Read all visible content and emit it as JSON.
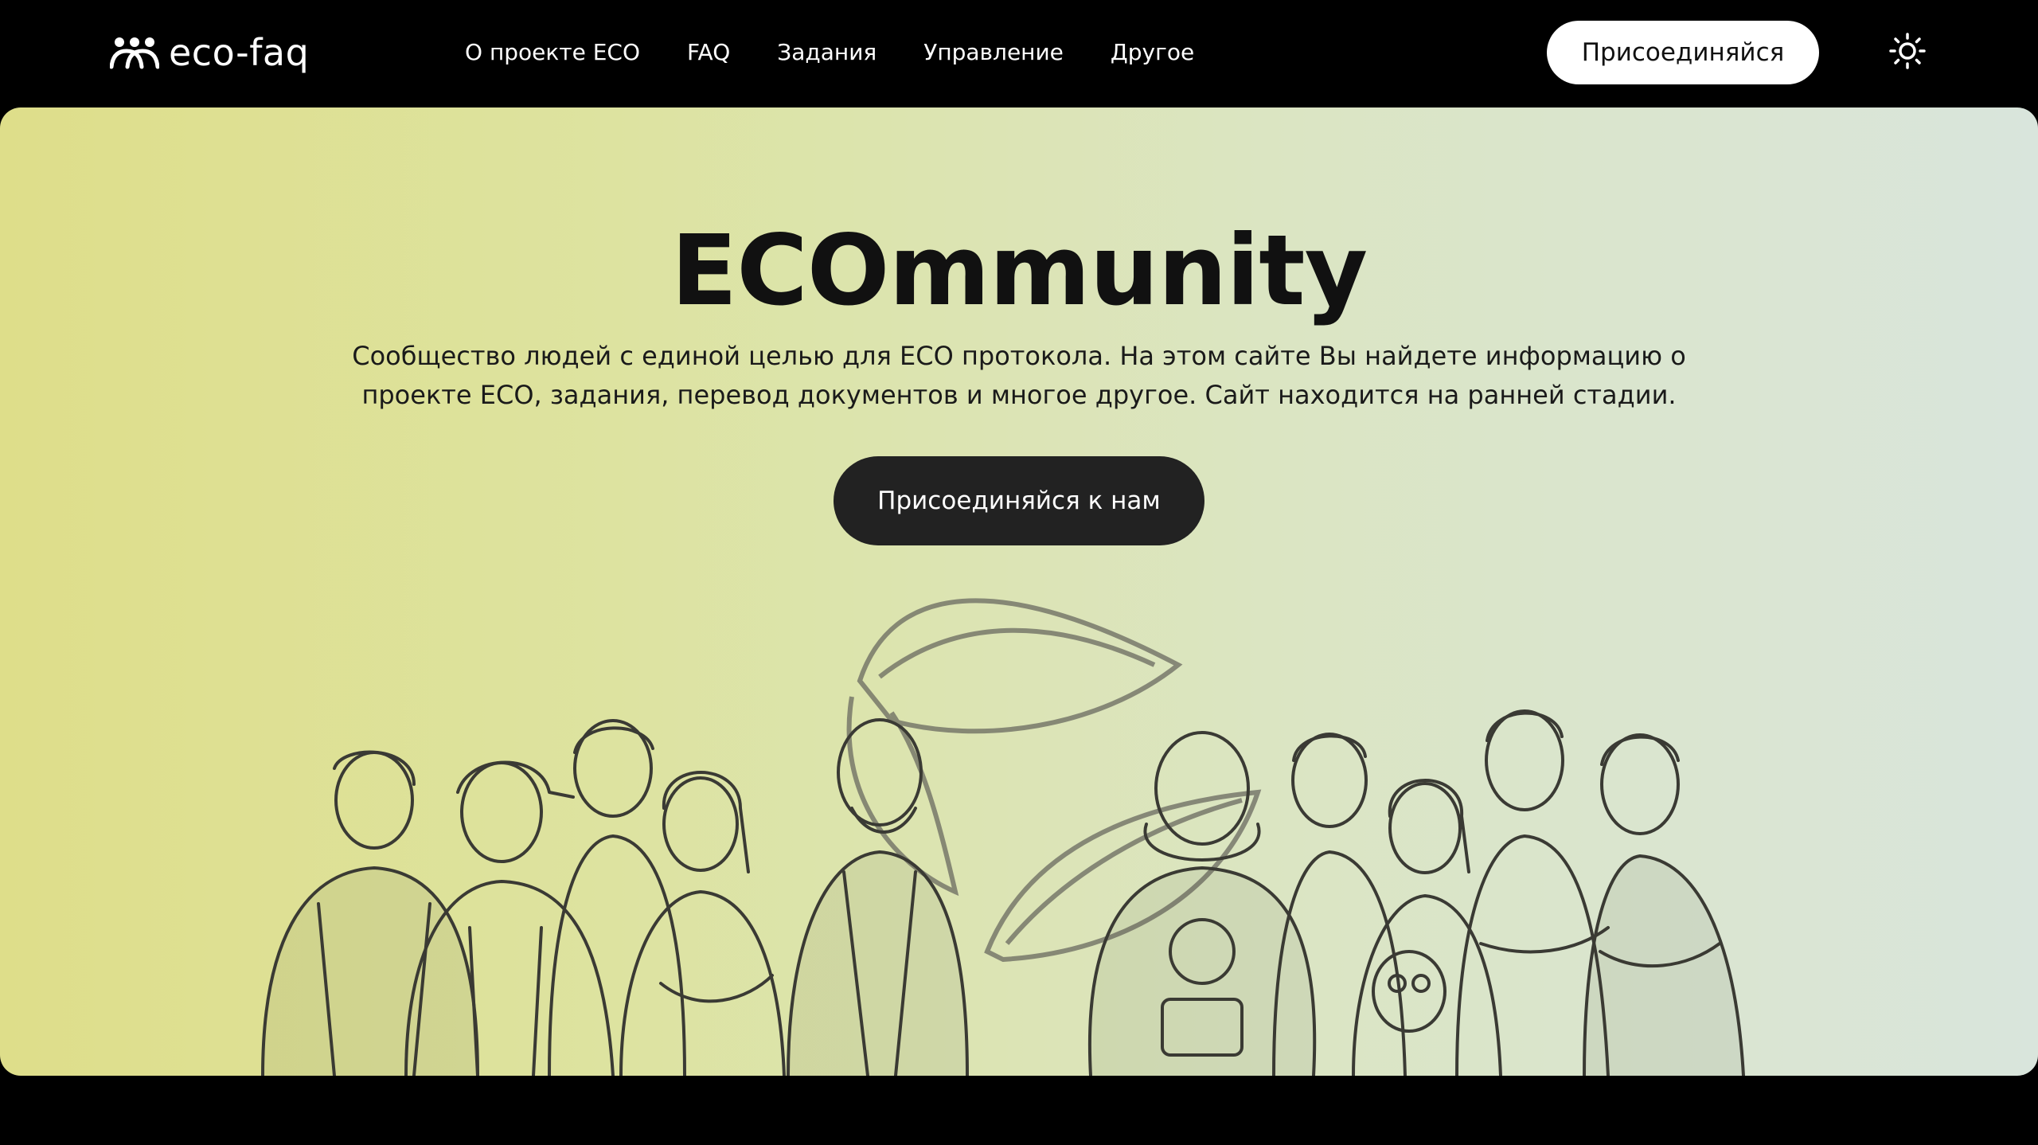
{
  "header": {
    "logo_text": "eco-faq",
    "logo_icon": "people-group-icon",
    "nav": [
      {
        "label": "О проекте ECO"
      },
      {
        "label": "FAQ"
      },
      {
        "label": "Задания"
      },
      {
        "label": "Управление"
      },
      {
        "label": "Другое"
      }
    ],
    "join_label": "Присоединяйся",
    "theme_icon": "sun-icon"
  },
  "hero": {
    "title": "ECOmmunity",
    "description": "Сообщество людей с единой целью для ECO протокола. На этом сайте Вы найдете информацию о проекте ECO, задания, перевод документов и многое другое. Сайт находится на ранней стадии.",
    "cta_label": "Присоединяйся к нам",
    "illustration": "community-members-sketch"
  },
  "colors": {
    "background": "#000000",
    "hero_gradient_start": "#dede8a",
    "hero_gradient_end": "#d9e5dc",
    "cta_dark": "#222222",
    "button_light": "#ffffff"
  }
}
